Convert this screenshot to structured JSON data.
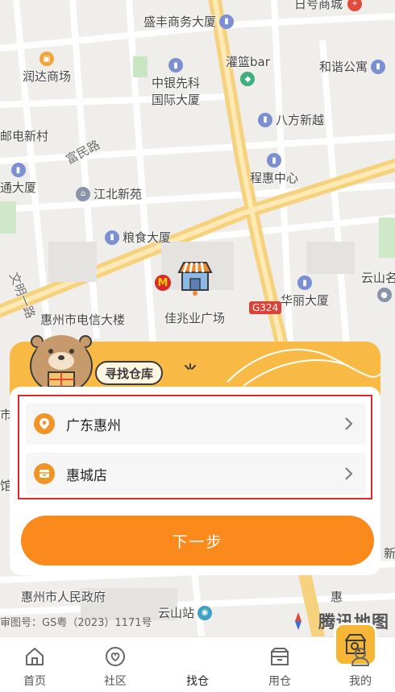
{
  "map": {
    "pois": [
      {
        "name": "盛丰商务大厦",
        "type": "building"
      },
      {
        "name": "日号商城",
        "type": "building"
      },
      {
        "name": "润达商场",
        "type": "shop"
      },
      {
        "name": "中银先科",
        "type": "building"
      },
      {
        "name": "国际大厦",
        "type": "text"
      },
      {
        "name": "灌篮bar",
        "type": "building"
      },
      {
        "name": "和谐公寓",
        "type": "building"
      },
      {
        "name": "邮电新村",
        "type": "text"
      },
      {
        "name": "八方新越",
        "type": "building"
      },
      {
        "name": "富民路",
        "type": "road"
      },
      {
        "name": "程惠中心",
        "type": "building"
      },
      {
        "name": "通大厦",
        "type": "building"
      },
      {
        "name": "江北新苑",
        "type": "home"
      },
      {
        "name": "粮食大厦",
        "type": "building"
      },
      {
        "name": "云山名",
        "type": "building"
      },
      {
        "name": "文明一路",
        "type": "road"
      },
      {
        "name": "华丽大厦",
        "type": "building"
      },
      {
        "name": "惠州市电信大楼",
        "type": "text"
      },
      {
        "name": "佳兆业广场",
        "type": "text"
      },
      {
        "name": "G324",
        "type": "badge"
      },
      {
        "name": "惠州市人民政府",
        "type": "text"
      },
      {
        "name": "云山站",
        "type": "text"
      },
      {
        "name": "惠",
        "type": "text"
      },
      {
        "name": "新",
        "type": "text"
      },
      {
        "name": "市",
        "type": "text"
      },
      {
        "name": "馆",
        "type": "text"
      }
    ],
    "credit": "审图号：GS粤（2023）1171号",
    "logo": "腾讯地图"
  },
  "card": {
    "title": "寻找仓库",
    "region": "广东惠州",
    "store": "惠城店",
    "next_label": "下一步"
  },
  "tabs": [
    {
      "label": "首页",
      "icon": "home-icon"
    },
    {
      "label": "社区",
      "icon": "community-heart-icon"
    },
    {
      "label": "找仓",
      "icon": "find-warehouse-icon"
    },
    {
      "label": "用仓",
      "icon": "box-icon"
    },
    {
      "label": "我的",
      "icon": "user-icon"
    }
  ],
  "colors": {
    "accent": "#fb8a1d",
    "card_head": "#f8ba45",
    "highlight_border": "#e0262f"
  }
}
